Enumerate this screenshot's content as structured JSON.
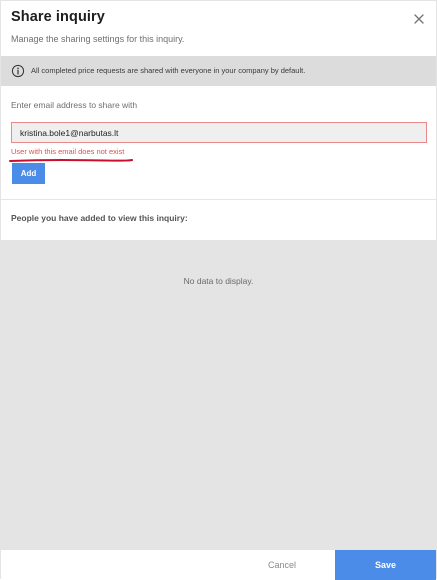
{
  "dialog": {
    "title": "Share inquiry",
    "subtitle": "Manage the sharing settings for this inquiry.",
    "close_icon": "close-icon"
  },
  "info": {
    "icon": "info-icon",
    "text": "All completed price requests are shared with everyone in your company by default."
  },
  "email_form": {
    "label": "Enter email address to share with",
    "value": "kristina.bole1@narbutas.lt",
    "error": "User with this email does not exist",
    "add_label": "Add"
  },
  "people": {
    "heading": "People you have added to view this inquiry:",
    "empty_message": "No data to display."
  },
  "footer": {
    "cancel_label": "Cancel",
    "save_label": "Save"
  },
  "colors": {
    "primary": "#4b8ce8",
    "error": "#d9534f",
    "annotation_underline": "#c8102e",
    "info_bar": "#dcdcdc",
    "list_background": "#e4e4e4"
  }
}
